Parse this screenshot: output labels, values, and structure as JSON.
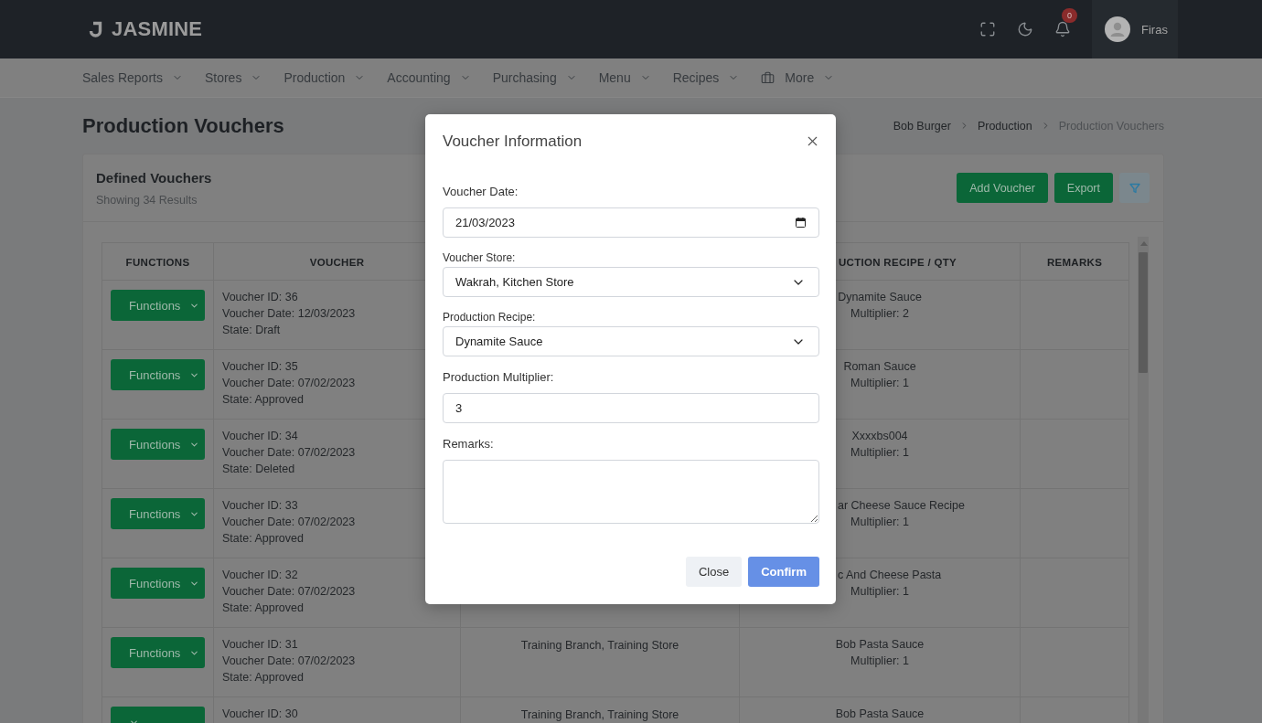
{
  "header": {
    "logo": "JASMINE",
    "notification_count": "0",
    "user_name": "Firas"
  },
  "nav": [
    {
      "label": "Sales Reports",
      "kind": "menu"
    },
    {
      "label": "Stores",
      "kind": "menu"
    },
    {
      "label": "Production",
      "kind": "menu"
    },
    {
      "label": "Accounting",
      "kind": "menu"
    },
    {
      "label": "Purchasing",
      "kind": "menu"
    },
    {
      "label": "Menu",
      "kind": "menu"
    },
    {
      "label": "Recipes",
      "kind": "menu"
    },
    {
      "label": "More",
      "kind": "menu-with-icon"
    }
  ],
  "page": {
    "title": "Production Vouchers",
    "breadcrumb": [
      {
        "label": "Bob Burger",
        "current": false
      },
      {
        "label": "Production",
        "current": false
      },
      {
        "label": "Production Vouchers",
        "current": true
      }
    ]
  },
  "card": {
    "title": "Defined Vouchers",
    "subtitle": "Showing 34 Results",
    "buttons": [
      {
        "label": "Add Voucher",
        "kind": "text"
      },
      {
        "label": "Export",
        "kind": "text"
      },
      {
        "kind": "filter"
      }
    ]
  },
  "table": {
    "columns": [
      {
        "label": "FUNCTIONS",
        "cut": false
      },
      {
        "label": "VOUCHER",
        "cut": false
      },
      null,
      {
        "label": "UCTION RECIPE / QTY",
        "cut": true
      },
      {
        "label": "REMARKS",
        "cut": false
      }
    ],
    "rows": [
      {
        "functions": "Functions",
        "voucher": [
          "Voucher ID: 36",
          "Voucher Date: 12/03/2023",
          "State: Draft"
        ],
        "column_4": [
          {
            "text": "Dynamite Sauce",
            "cut": false
          },
          {
            "text": "Multiplier: 2",
            "cut": false
          }
        ]
      },
      {
        "functions": "Functions",
        "voucher": [
          "Voucher ID: 35",
          "Voucher Date: 07/02/2023",
          "State: Approved"
        ],
        "column_4": [
          {
            "text": "Roman Sauce",
            "cut": false
          },
          {
            "text": "Multiplier: 1",
            "cut": false
          }
        ]
      },
      {
        "functions": "Functions",
        "voucher": [
          "Voucher ID: 34",
          "Voucher Date: 07/02/2023",
          "State: Deleted"
        ],
        "column_4": [
          {
            "text": "Xxxxbs004",
            "cut": false
          },
          {
            "text": "Multiplier: 1",
            "cut": false
          }
        ]
      },
      {
        "functions": "Functions",
        "voucher": [
          "Voucher ID: 33",
          "Voucher Date: 07/02/2023",
          "State: Approved"
        ],
        "column_4": [
          {
            "text": "ar Cheese Sauce Recipe",
            "cut": true
          },
          {
            "text": "Multiplier: 1",
            "cut": false
          }
        ]
      },
      {
        "functions": "Functions",
        "voucher": [
          "Voucher ID: 32",
          "Voucher Date: 07/02/2023",
          "State: Approved"
        ],
        "column_4": [
          {
            "text": "c And Cheese Pasta",
            "cut": true
          },
          {
            "text": "Multiplier: 1",
            "cut": false
          }
        ]
      },
      {
        "functions": "Functions",
        "voucher": [
          "Voucher ID: 31",
          "Voucher Date: 07/02/2023",
          "State: Approved"
        ],
        "column_3": "Training Branch, Training Store",
        "column_4": [
          {
            "text": "Bob Pasta Sauce",
            "cut": false
          },
          {
            "text": "Multiplier: 1",
            "cut": false
          }
        ]
      },
      {
        "voucher": [
          "Voucher ID: 30"
        ],
        "column_3": "Training Branch, Training Store",
        "column_4": [
          {
            "text": "Bob Pasta Sauce",
            "cut": false
          }
        ]
      }
    ]
  },
  "modal": {
    "title": "Voucher Information",
    "fields": [
      {
        "label": "Voucher Date:",
        "kind": "date",
        "value": "21/03/2023"
      },
      {
        "label": "Voucher Store:",
        "kind": "select",
        "value": "Wakrah, Kitchen Store"
      },
      {
        "label": "Production Recipe:",
        "kind": "select",
        "value": "Dynamite Sauce"
      },
      {
        "label": "Production Multiplier:",
        "kind": "text",
        "value": "3"
      },
      {
        "label": "Remarks:",
        "kind": "textarea"
      }
    ],
    "buttons": [
      {
        "label": "Close",
        "kind": "secondary"
      },
      {
        "label": "Confirm",
        "kind": "primary"
      }
    ]
  }
}
